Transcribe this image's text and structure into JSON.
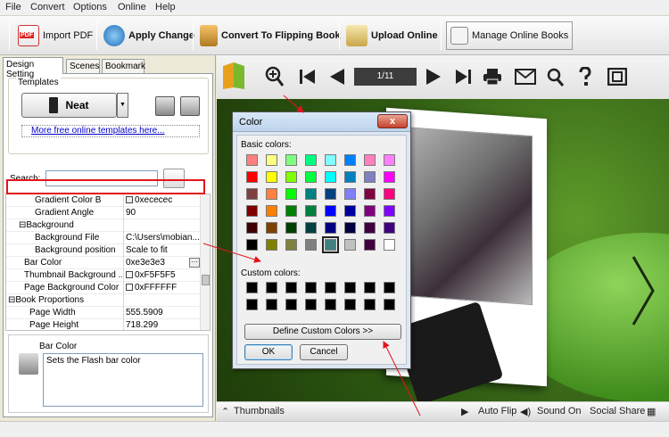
{
  "menu": [
    "File",
    "Convert",
    "Options",
    "Online",
    "Help"
  ],
  "toolbar": {
    "import_pdf": "Import PDF",
    "apply_change": "Apply Change",
    "convert": "Convert To Flipping Book",
    "upload": "Upload Online",
    "manage": "Manage Online Books"
  },
  "tabs": [
    "Design Setting",
    "Scenes",
    "Bookmark"
  ],
  "templates": {
    "label": "Templates",
    "selected": "Neat",
    "more_link": "More free online templates here..."
  },
  "search": {
    "label": "Search:",
    "value": ""
  },
  "properties": [
    {
      "name": "Gradient Color B",
      "value": "0xececec",
      "check": true,
      "indent": 2
    },
    {
      "name": "Gradient Angle",
      "value": "90",
      "check": false,
      "indent": 2
    },
    {
      "name": "Background",
      "value": "",
      "check": false,
      "indent": 1,
      "toggle": "⊟"
    },
    {
      "name": "Background File",
      "value": "C:\\Users\\mobian...",
      "check": false,
      "indent": 2
    },
    {
      "name": "Background position",
      "value": "Scale to fit",
      "check": false,
      "indent": 2
    },
    {
      "name": "Bar Color",
      "value": "0xe3e3e3",
      "check": false,
      "indent": 1
    },
    {
      "name": "Thumbnail Background ...",
      "value": "0xF5F5F5",
      "check": true,
      "indent": 1
    },
    {
      "name": "Page Background Color",
      "value": "0xFFFFFF",
      "check": true,
      "indent": 1
    },
    {
      "name": "Book Proportions",
      "value": "",
      "check": false,
      "indent": 0,
      "toggle": "⊟"
    },
    {
      "name": "Page Width",
      "value": "555.5909",
      "check": false,
      "indent": 2
    },
    {
      "name": "Page Height",
      "value": "718.299",
      "check": false,
      "indent": 2
    }
  ],
  "info": {
    "title": "Bar Color",
    "description": "Sets the Flash bar color"
  },
  "viewer": {
    "page_indicator": "1/11",
    "thumbnails": "Thumbnails",
    "auto_flip": "Auto Flip",
    "sound_on": "Sound On",
    "social_share": "Social Share"
  },
  "color_dialog": {
    "title": "Color",
    "close": "x",
    "basic_colors_label": "Basic colors:",
    "custom_colors_label": "Custom colors:",
    "define_button": "Define Custom Colors >>",
    "ok": "OK",
    "cancel": "Cancel",
    "basic_colors": [
      "#ff8080",
      "#ffff80",
      "#80ff80",
      "#00ff80",
      "#80ffff",
      "#0080ff",
      "#ff80c0",
      "#ff80ff",
      "#ff0000",
      "#ffff00",
      "#80ff00",
      "#00ff40",
      "#00ffff",
      "#0080c0",
      "#8080c0",
      "#ff00ff",
      "#804040",
      "#ff8040",
      "#00ff00",
      "#008080",
      "#004080",
      "#8080ff",
      "#800040",
      "#ff0080",
      "#800000",
      "#ff8000",
      "#008000",
      "#008040",
      "#0000ff",
      "#0000a0",
      "#800080",
      "#8000ff",
      "#400000",
      "#804000",
      "#004000",
      "#004040",
      "#000080",
      "#000040",
      "#400040",
      "#400080",
      "#000000",
      "#808000",
      "#808040",
      "#808080",
      "#408080",
      "#c0c0c0",
      "#400040",
      "#ffffff"
    ],
    "selected_index": 44,
    "custom_colors": [
      "#000000",
      "#000000",
      "#000000",
      "#000000",
      "#000000",
      "#000000",
      "#000000",
      "#000000",
      "#000000",
      "#000000",
      "#000000",
      "#000000",
      "#000000",
      "#000000",
      "#000000",
      "#000000"
    ]
  },
  "colors": {
    "highlight": "#e3141c",
    "arrow": "#e3141c"
  }
}
